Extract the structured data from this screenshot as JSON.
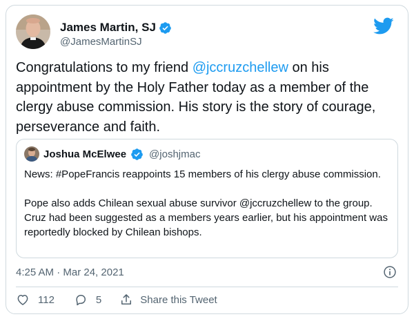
{
  "author": {
    "name": "James Martin, SJ",
    "handle": "@JamesMartinSJ"
  },
  "tweet": {
    "text_before": "Congratulations to my friend ",
    "mention": "@jccruzchellew",
    "text_after": " on his appointment by the Holy Father today as a member of the clergy abuse commission. His story is the story of courage, perseverance and faith."
  },
  "quote": {
    "name": "Joshua McElwee",
    "handle": "@joshjmac",
    "paragraph1": "News: #PopeFrancis reappoints 15 members of his clergy abuse commission.",
    "paragraph2": "Pope also adds Chilean sexual abuse survivor @jccruzchellew to the group. Cruz had been suggested as a members years earlier, but his appointment was reportedly blocked by Chilean bishops."
  },
  "timestamp": "4:25 AM · Mar 24, 2021",
  "actions": {
    "likes": "112",
    "replies": "5",
    "share_label": "Share this Tweet"
  },
  "icons": {
    "verified": "verified-badge-icon",
    "twitter": "twitter-bird-icon",
    "info": "info-icon",
    "like": "heart-icon",
    "reply": "reply-bubble-icon",
    "share": "share-icon"
  },
  "colors": {
    "accent": "#1d9bf0",
    "text": "#0f1419",
    "muted": "#536471",
    "border": "#cfd9de"
  }
}
